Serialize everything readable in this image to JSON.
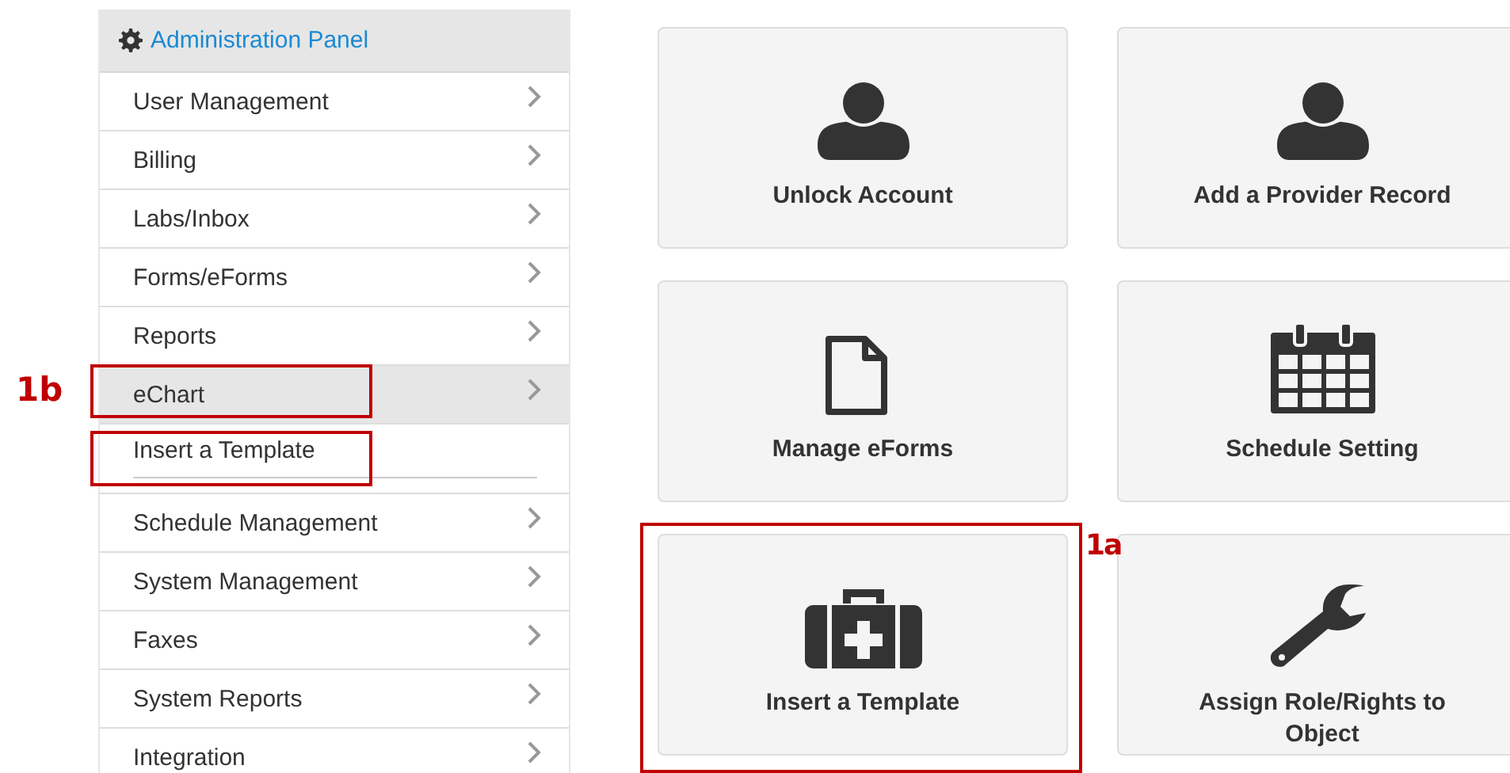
{
  "sidebar": {
    "title": "Administration Panel",
    "items": [
      {
        "label": "User Management",
        "selected": false,
        "highlighted": false
      },
      {
        "label": "Billing",
        "selected": false,
        "highlighted": false
      },
      {
        "label": "Labs/Inbox",
        "selected": false,
        "highlighted": false
      },
      {
        "label": "Forms/eForms",
        "selected": false,
        "highlighted": false
      },
      {
        "label": "Reports",
        "selected": false,
        "highlighted": false
      },
      {
        "label": "eChart",
        "selected": true,
        "highlighted": true,
        "callout": "1b",
        "children": [
          {
            "label": "Insert a Template",
            "highlighted": true
          }
        ]
      },
      {
        "label": "Schedule Management",
        "selected": false,
        "highlighted": false
      },
      {
        "label": "System Management",
        "selected": false,
        "highlighted": false
      },
      {
        "label": "Faxes",
        "selected": false,
        "highlighted": false
      },
      {
        "label": "System Reports",
        "selected": false,
        "highlighted": false
      },
      {
        "label": "Integration",
        "selected": false,
        "highlighted": false
      }
    ]
  },
  "tiles": [
    {
      "label": "Unlock Account",
      "highlighted": false
    },
    {
      "label": "Add a Provider Record",
      "highlighted": false
    },
    {
      "label": "Manage eForms",
      "highlighted": false
    },
    {
      "label": "Schedule Setting",
      "highlighted": false
    },
    {
      "label": "Insert a Template",
      "highlighted": true,
      "callout": "1a"
    },
    {
      "label": "Assign Role/Rights to Object",
      "highlighted": false
    }
  ]
}
